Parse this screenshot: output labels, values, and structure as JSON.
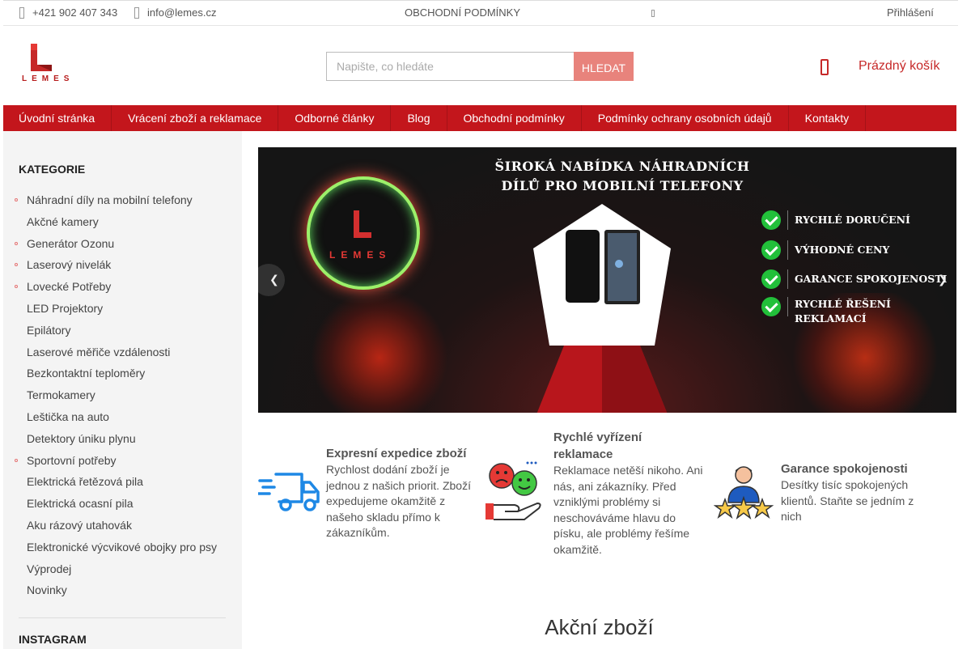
{
  "topbar": {
    "phone": "+421 902 407 343",
    "email": "info@lemes.cz",
    "terms": "OBCHODNÍ PODMÍNKY",
    "login": "Přihlášení"
  },
  "logo": {
    "text": "LEMES"
  },
  "search": {
    "placeholder": "Napište, co hledáte",
    "button": "HLEDAT"
  },
  "cart": {
    "label": "Prázdný košík"
  },
  "nav": [
    "Úvodní stránka",
    "Vrácení zboží a reklamace",
    "Odborné články",
    "Blog",
    "Obchodní podmínky",
    "Podmínky ochrany osobních údajů",
    "Kontakty"
  ],
  "sidebar": {
    "heading": "KATEGORIE",
    "categories": [
      {
        "label": "Náhradní díly na mobilní telefony",
        "sub": true
      },
      {
        "label": "Akčné kamery",
        "sub": false
      },
      {
        "label": "Generátor Ozonu",
        "sub": true
      },
      {
        "label": "Laserový nivelák",
        "sub": true
      },
      {
        "label": "Lovecké Potřeby",
        "sub": true
      },
      {
        "label": "LED Projektory",
        "sub": false
      },
      {
        "label": "Epilátory",
        "sub": false
      },
      {
        "label": "Laserové měřiče vzdálenosti",
        "sub": false
      },
      {
        "label": "Bezkontaktní teploměry",
        "sub": false
      },
      {
        "label": "Termokamery",
        "sub": false
      },
      {
        "label": "Leštička na auto",
        "sub": false
      },
      {
        "label": "Detektory úniku plynu",
        "sub": false
      },
      {
        "label": "Sportovní potřeby",
        "sub": true
      },
      {
        "label": "Elektrická řetězová pila",
        "sub": false
      },
      {
        "label": "Elektrická ocasní pila",
        "sub": false
      },
      {
        "label": "Aku rázový utahovák",
        "sub": false
      },
      {
        "label": "Elektronické výcvikové obojky pro psy",
        "sub": false
      },
      {
        "label": "Výprodej",
        "sub": false
      },
      {
        "label": "Novinky",
        "sub": false
      }
    ],
    "instagram_heading": "INSTAGRAM"
  },
  "banner": {
    "headline_line1": "ŠIROKÁ NABÍDKA NÁHRADNÍCH",
    "headline_line2": "DÍLŮ PRO MOBILNÍ TELEFONY",
    "logo_text": "LEMES",
    "bullets": [
      "RYCHLÉ DORUČENÍ",
      "VÝHODNÉ CENY",
      "GARANCE SPOKOJENOSTI",
      "RYCHLÉ ŘEŠENÍ REKLAMACÍ"
    ],
    "prev_icon": "chevron-left-icon",
    "next_icon": "chevron-right-icon"
  },
  "features": [
    {
      "title": "Expresní expedice zboží",
      "desc": "Rychlost dodání zboží je jednou z našich priorit. Zboží expedujeme okamžitě z našeho skladu přímo k zákazníkům.",
      "icon": "delivery-truck-icon"
    },
    {
      "title": "Rychlé vyřízení reklamace",
      "desc": "Reklamace netěší nikoho. Ani nás, ani zákazníky. Před vzniklými problémy si neschováváme hlavu do písku, ale problémy řešíme okamžitě.",
      "icon": "smiley-hand-icon"
    },
    {
      "title": "Garance spokojenosti",
      "desc": "Desítky tisíc spokojených klientů. Staňte se jedním z nich",
      "icon": "person-stars-icon"
    }
  ],
  "section_title": "Akční zboží",
  "colors": {
    "brand_red": "#c3161c",
    "search_button": "#e8837c",
    "cart_red": "#c62828"
  }
}
